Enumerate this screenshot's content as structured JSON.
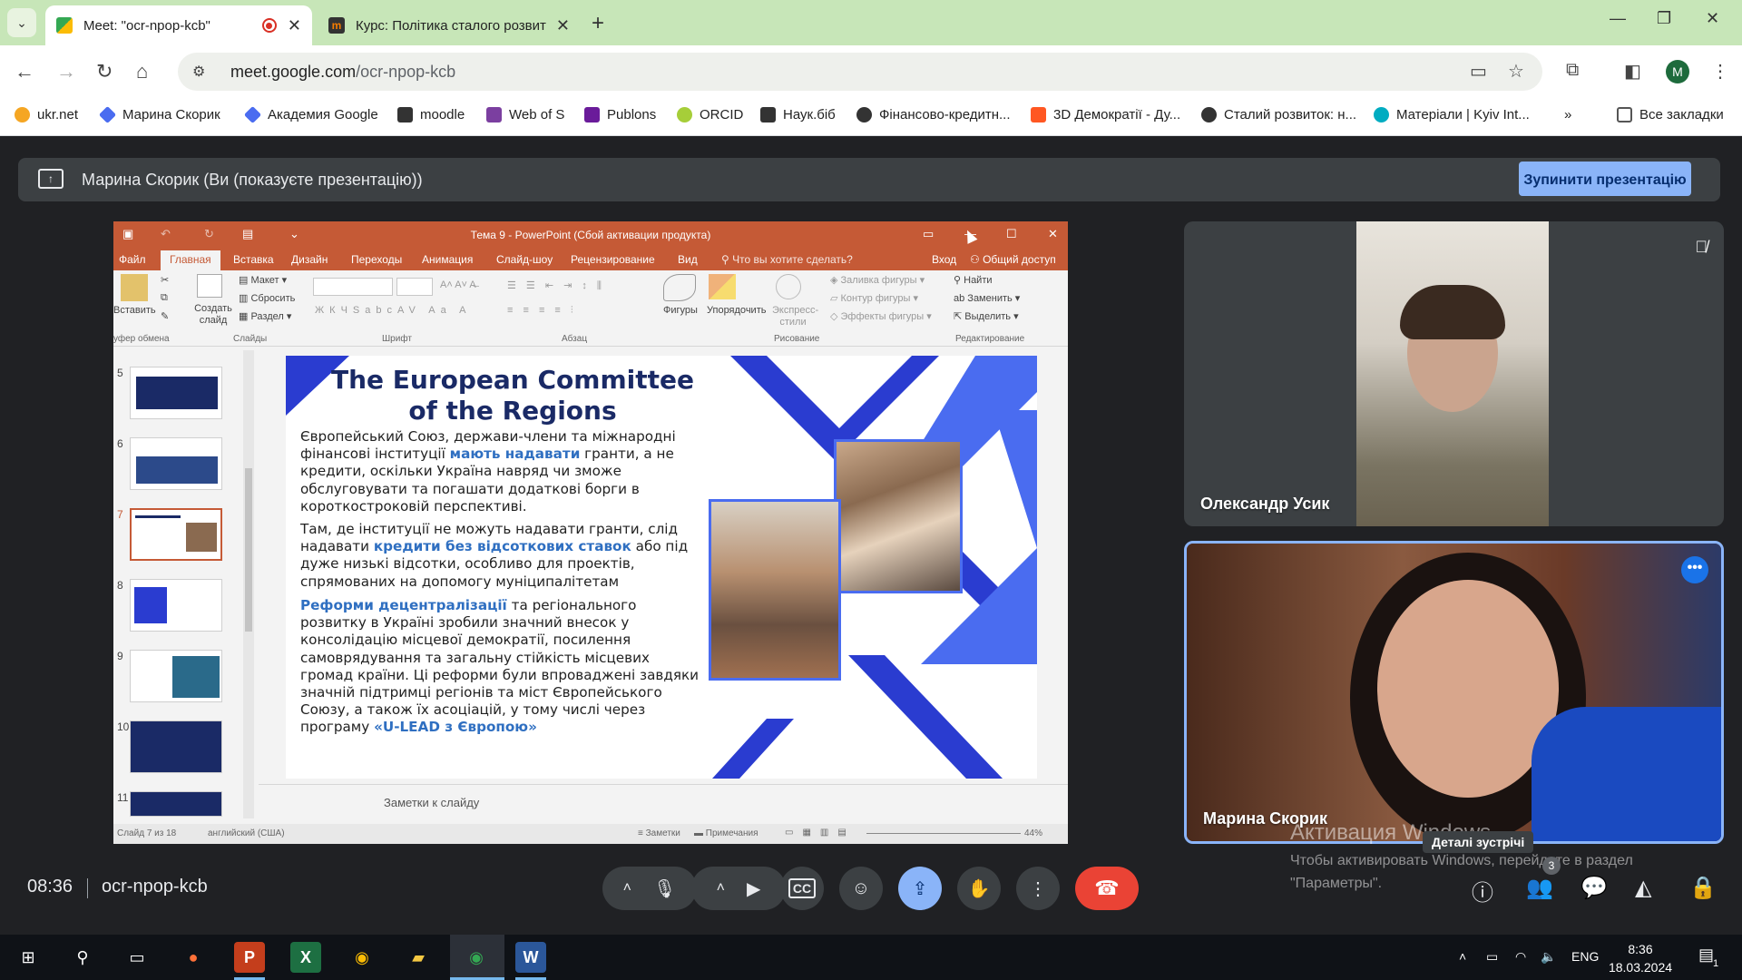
{
  "browser": {
    "tabs": [
      {
        "title": "Meet: \"ocr-npop-kcb\"",
        "active": true
      },
      {
        "title": "Курс: Політика сталого розвит",
        "active": false
      }
    ],
    "url_host": "meet.google.com",
    "url_path": "/ocr-npop-kcb",
    "profile_initial": "M",
    "bookmarks": [
      {
        "label": "ukr.net",
        "color": "#f5a623"
      },
      {
        "label": "Марина Скорик",
        "color": "#4a6cf0"
      },
      {
        "label": "Академия Google",
        "color": "#4a6cf0"
      },
      {
        "label": "moodle",
        "color": "#f57c00"
      },
      {
        "label": "Web of S",
        "color": "#7b3fa0"
      },
      {
        "label": "Publons",
        "color": "#6a1b9a"
      },
      {
        "label": "ORCID",
        "color": "#a6ce39"
      },
      {
        "label": "Наук.біб",
        "color": "#333333"
      },
      {
        "label": "Фінансово-кредитн...",
        "color": "#333333"
      },
      {
        "label": "3D Демократії - Ду...",
        "color": "#ff5722"
      },
      {
        "label": "Сталий розвиток: н...",
        "color": "#333333"
      },
      {
        "label": "Матеріали | Kyiv Int...",
        "color": "#00acc1"
      }
    ],
    "all_bookmarks": "Все закладки"
  },
  "meet": {
    "presenting_text": "Марина Скорик (Ви (показуєте презентацію))",
    "stop_button": "Зупинити презентацію",
    "time": "08:36",
    "meeting_code": "ocr-npop-kcb",
    "participants_count": "3",
    "tooltip": "Деталі зустрічі",
    "participants": [
      {
        "name": "Олександр Усик",
        "muted": true
      },
      {
        "name": "Марина Скорик",
        "muted": false
      }
    ]
  },
  "powerpoint": {
    "window_title": "Тема 9 - PowerPoint (Сбой активации продукта)",
    "tabs": [
      "Файл",
      "Главная",
      "Вставка",
      "Дизайн",
      "Переходы",
      "Анимация",
      "Слайд-шоу",
      "Рецензирование",
      "Вид"
    ],
    "tell_me": "Что вы хотите сделать?",
    "signin": "Вход",
    "share": "Общий доступ",
    "ribbon": {
      "paste": "Вставить",
      "new_slide": "Создать слайд",
      "layout": "Макет",
      "reset": "Сбросить",
      "section": "Раздел",
      "shapes": "Фигуры",
      "arrange": "Упорядочить",
      "quick_styles": "Экспресс-стили",
      "shape_fill": "Заливка фигуры",
      "shape_outline": "Контур фигуры",
      "shape_effects": "Эффекты фигуры",
      "find": "Найти",
      "replace": "Заменить",
      "select": "Выделить",
      "groups": [
        "уфер обмена",
        "Слайды",
        "Шрифт",
        "Абзац",
        "Рисование",
        "Редактирование"
      ]
    },
    "thumbnails": [
      "5",
      "6",
      "7",
      "8",
      "9",
      "10",
      "11"
    ],
    "selected_slide": "7",
    "notes_placeholder": "Заметки к слайду",
    "status_left": "Слайд 7 из 18",
    "status_lang": "английский (США)",
    "status_notes": "Заметки",
    "status_comments": "Примечания",
    "zoom": "44%",
    "slide": {
      "title": "The European Committee of the Regions",
      "p1_a": "Європейський Союз, держави-члени та міжнародні фінансові інституції ",
      "p1_hl": "мають надавати",
      "p1_b": " гранти, а не кредити, оскільки Україна навряд чи зможе обслуговувати та погашати додаткові борги в короткостроковій перспективі.",
      "p2_a": "Там, де інституції не можуть надавати гранти, слід надавати ",
      "p2_hl": "кредити без відсоткових ставок",
      "p2_b": " або під дуже низькі відсотки, особливо для проектів, спрямованих на допомогу муніципалітетам",
      "p3_hl": "Реформи децентралізації",
      "p3_a": " та регіонального розвитку в Україні зробили значний внесок у консолідацію місцевої демократії, посилення самоврядування та загальну стійкість місцевих громад країни. Ці реформи були впроваджені завдяки значній підтримці регіонів та міст Європейського Союзу, а також їх асоціацій, у тому числі через програму ",
      "p3_hl2": "«U-LEAD з Європою»"
    }
  },
  "windows": {
    "watermark_title": "Активация Windows",
    "watermark_text": "Чтобы активировать Windows, перейдите в раздел \"Параметры\".",
    "lang": "ENG",
    "clock_time": "8:36",
    "clock_date": "18.03.2024",
    "notif_count": "1"
  },
  "colors": {
    "tab_strip": "#c7e6b8",
    "ppt_accent": "#c55a36",
    "slide_navy": "#1a2a66",
    "slide_blue": "#4a6cf0",
    "meet_bg": "#202124",
    "end_call": "#ea4335",
    "present_active": "#8ab4f8"
  }
}
